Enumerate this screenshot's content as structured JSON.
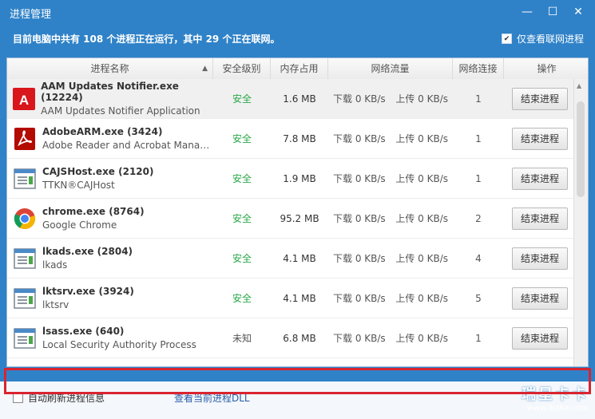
{
  "window": {
    "title": "进程管理",
    "minimize": "—",
    "restore": "☐",
    "close": "✕"
  },
  "info": {
    "summary": "目前电脑中共有 108 个进程正在运行，其中 29 个正在联网。",
    "net_only_label": "仅查看联网进程",
    "net_only_checked": true
  },
  "table": {
    "headers": {
      "name": "进程名称",
      "security": "安全级别",
      "memory": "内存占用",
      "traffic": "网络流量",
      "connections": "网络连接",
      "operation": "操作"
    },
    "rows": [
      {
        "name": "AAM Updates Notifier.exe (12224)",
        "desc": "AAM Updates Notifier Application",
        "icon": "adobe-icon",
        "security": "安全",
        "memory": "1.6 MB",
        "down": "下载 0 KB/s",
        "up": "上传 0 KB/s",
        "conn": "1",
        "action": "结束进程"
      },
      {
        "name": "AdobeARM.exe (3424)",
        "desc": "Adobe Reader and Acrobat Manager",
        "icon": "acrobat-icon",
        "security": "安全",
        "memory": "7.8 MB",
        "down": "下载 0 KB/s",
        "up": "上传 0 KB/s",
        "conn": "1",
        "action": "结束进程"
      },
      {
        "name": "CAJSHost.exe (2120)",
        "desc": "TTKN®CAJHost",
        "icon": "window-app-icon",
        "security": "安全",
        "memory": "1.9 MB",
        "down": "下载 0 KB/s",
        "up": "上传 0 KB/s",
        "conn": "1",
        "action": "结束进程"
      },
      {
        "name": "chrome.exe (8764)",
        "desc": "Google Chrome",
        "icon": "chrome-icon",
        "security": "安全",
        "memory": "95.2 MB",
        "down": "下载 0 KB/s",
        "up": "上传 0 KB/s",
        "conn": "2",
        "action": "结束进程"
      },
      {
        "name": "lkads.exe (2804)",
        "desc": "lkads",
        "icon": "window-app-icon",
        "security": "安全",
        "memory": "4.1 MB",
        "down": "下载 0 KB/s",
        "up": "上传 0 KB/s",
        "conn": "4",
        "action": "结束进程"
      },
      {
        "name": "lktsrv.exe (3924)",
        "desc": "lktsrv",
        "icon": "window-app-icon",
        "security": "安全",
        "memory": "4.1 MB",
        "down": "下载 0 KB/s",
        "up": "上传 0 KB/s",
        "conn": "5",
        "action": "结束进程"
      },
      {
        "name": "lsass.exe (640)",
        "desc": "Local Security Authority Process",
        "icon": "window-app-icon",
        "security": "未知",
        "memory": "6.8 MB",
        "down": "下载 0 KB/s",
        "up": "上传 0 KB/s",
        "conn": "1",
        "action": "结束进程"
      }
    ]
  },
  "footer": {
    "auto_refresh": "自动刷新进程信息",
    "view_dll": "查看当前进程DLL",
    "watermark_big": "瑞星卡卡",
    "watermark_small": "www.ikaka.com"
  },
  "colors": {
    "title_bg": "#2f82c8",
    "safe": "#28a745",
    "highlight_box": "#d9242f"
  }
}
